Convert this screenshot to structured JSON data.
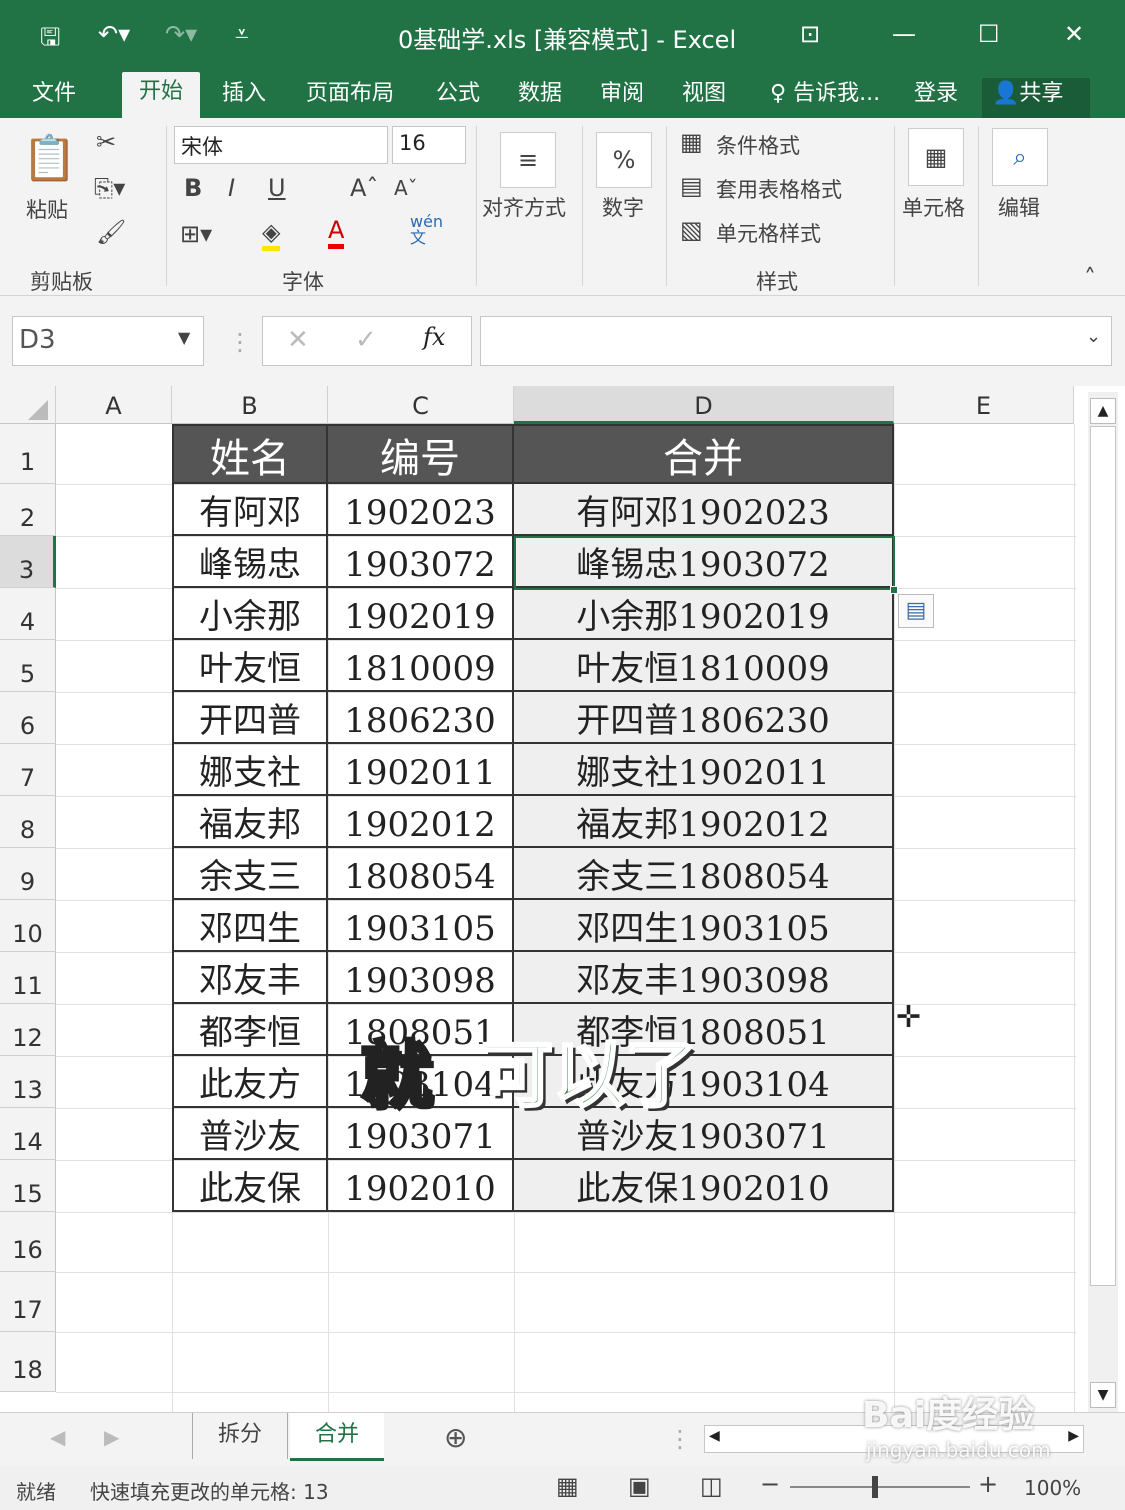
{
  "window": {
    "title": "0基础学.xls  [兼容模式] - Excel"
  },
  "menu_tabs": [
    "文件",
    "开始",
    "插入",
    "页面布局",
    "公式",
    "数据",
    "审阅",
    "视图",
    "告诉我...",
    "登录",
    "共享"
  ],
  "ribbon": {
    "paste": "粘贴",
    "clipboard": "剪贴板",
    "font_name": "宋体",
    "font_size": "16",
    "font_group": "字体",
    "align": "对齐方式",
    "number": "数字",
    "cond_format": "条件格式",
    "table_format": "套用表格格式",
    "cell_style": "单元格样式",
    "styles_group": "样式",
    "cells": "单元格",
    "edit": "编辑",
    "bold": "B",
    "italic": "I",
    "underline": "U",
    "wen": "wén\n文",
    "percent": "%",
    "font_color": "A"
  },
  "formula_bar": {
    "name_box": "D3",
    "fx": "fx",
    "value": ""
  },
  "columns": [
    "A",
    "B",
    "C",
    "D",
    "E"
  ],
  "row_numbers": [
    "1",
    "2",
    "3",
    "4",
    "5",
    "6",
    "7",
    "8",
    "9",
    "10",
    "11",
    "12",
    "13",
    "14",
    "15",
    "16",
    "17",
    "18"
  ],
  "table": {
    "headers": [
      "姓名",
      "编号",
      "合并"
    ],
    "rows": [
      [
        "有阿邓",
        "1902023",
        "有阿邓1902023"
      ],
      [
        "峰锡忠",
        "1903072",
        "峰锡忠1903072"
      ],
      [
        "小余那",
        "1902019",
        "小余那1902019"
      ],
      [
        "叶友恒",
        "1810009",
        "叶友恒1810009"
      ],
      [
        "开四普",
        "1806230",
        "开四普1806230"
      ],
      [
        "娜支社",
        "1902011",
        "娜支社1902011"
      ],
      [
        "福友邦",
        "1902012",
        "福友邦1902012"
      ],
      [
        "余支三",
        "1808054",
        "余支三1808054"
      ],
      [
        "邓四生",
        "1903105",
        "邓四生1903105"
      ],
      [
        "邓友丰",
        "1903098",
        "邓友丰1903098"
      ],
      [
        "都李恒",
        "1808051",
        "都李恒1808051"
      ],
      [
        "此友方",
        "1903104",
        "此友方1903104"
      ],
      [
        "普沙友",
        "1903071",
        "普沙友1903071"
      ],
      [
        "此友保",
        "1902010",
        "此友保1902010"
      ]
    ]
  },
  "sheets": [
    "拆分",
    "合并"
  ],
  "active_sheet": "合并",
  "status": {
    "ready": "就绪",
    "message": "快速填充更改的单元格: 13",
    "zoom": "100%"
  },
  "overlay": {
    "part1": "就",
    "part2": "可以了"
  },
  "watermark": {
    "brand": "Bai度经验",
    "url": "jingyan.baidu.com"
  },
  "colors": {
    "excel_green": "#217346",
    "header_fill": "#555555",
    "merged_fill": "#efefef"
  }
}
